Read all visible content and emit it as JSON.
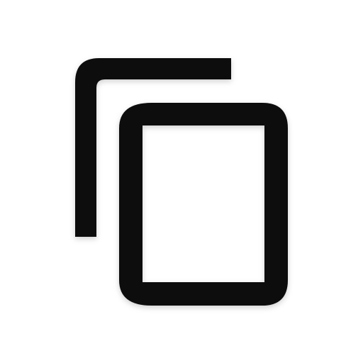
{
  "icon": {
    "name": "copy-icon",
    "color": "#0a0a0a",
    "background": "#ffffff"
  }
}
